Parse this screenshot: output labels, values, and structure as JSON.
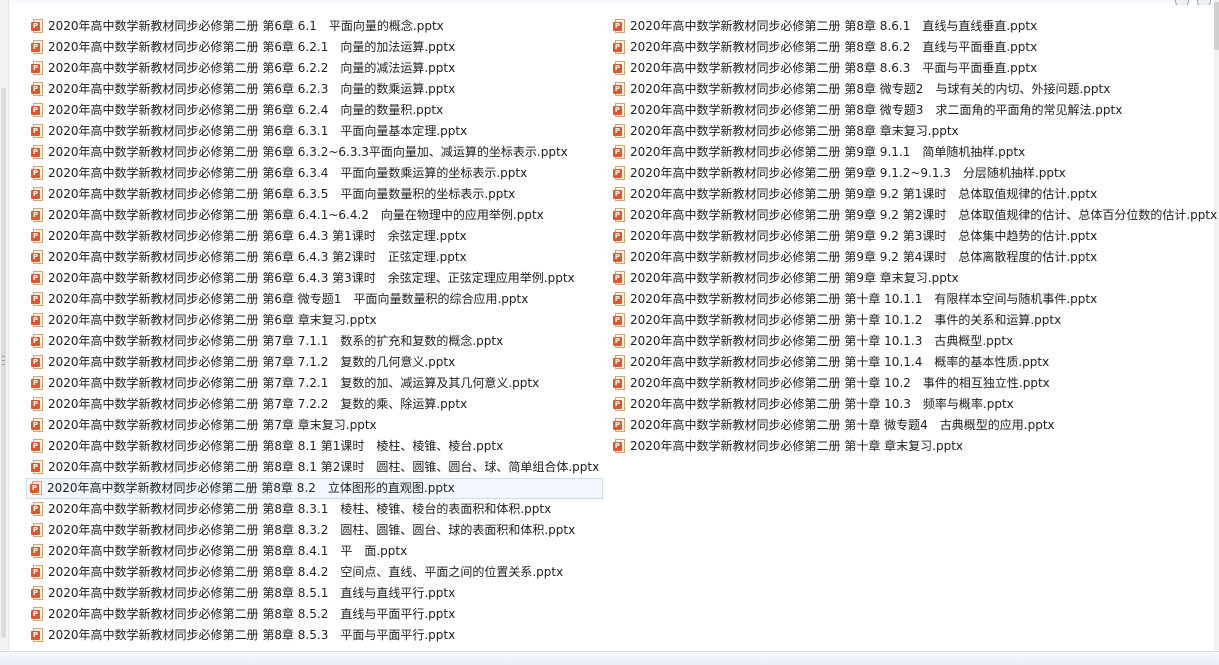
{
  "icon": {
    "name": "pptx-file-icon",
    "badge_letter": "P",
    "badge_color": "#e0572b"
  },
  "files_left": [
    "2020年高中数学新教材同步必修第二册 第6章 6.1　平面向量的概念.pptx",
    "2020年高中数学新教材同步必修第二册 第6章 6.2.1　向量的加法运算.pptx",
    "2020年高中数学新教材同步必修第二册 第6章 6.2.2　向量的减法运算.pptx",
    "2020年高中数学新教材同步必修第二册 第6章 6.2.3　向量的数乘运算.pptx",
    "2020年高中数学新教材同步必修第二册 第6章 6.2.4　向量的数量积.pptx",
    "2020年高中数学新教材同步必修第二册 第6章 6.3.1　平面向量基本定理.pptx",
    "2020年高中数学新教材同步必修第二册 第6章 6.3.2~6.3.3平面向量加、减运算的坐标表示.pptx",
    "2020年高中数学新教材同步必修第二册 第6章 6.3.4　平面向量数乘运算的坐标表示.pptx",
    "2020年高中数学新教材同步必修第二册 第6章 6.3.5　平面向量数量积的坐标表示.pptx",
    "2020年高中数学新教材同步必修第二册 第6章 6.4.1~6.4.2　向量在物理中的应用举例.pptx",
    "2020年高中数学新教材同步必修第二册 第6章 6.4.3 第1课时　余弦定理.pptx",
    "2020年高中数学新教材同步必修第二册 第6章 6.4.3 第2课时　正弦定理.pptx",
    "2020年高中数学新教材同步必修第二册 第6章 6.4.3 第3课时　余弦定理、正弦定理应用举例.pptx",
    "2020年高中数学新教材同步必修第二册 第6章 微专题1　平面向量数量积的综合应用.pptx",
    "2020年高中数学新教材同步必修第二册 第6章 章末复习.pptx",
    "2020年高中数学新教材同步必修第二册 第7章 7.1.1　数系的扩充和复数的概念.pptx",
    "2020年高中数学新教材同步必修第二册 第7章 7.1.2　复数的几何意义.pptx",
    "2020年高中数学新教材同步必修第二册 第7章 7.2.1　复数的加、减运算及其几何意义.pptx",
    "2020年高中数学新教材同步必修第二册 第7章 7.2.2　复数的乘、除运算.pptx",
    "2020年高中数学新教材同步必修第二册 第7章 章末复习.pptx",
    "2020年高中数学新教材同步必修第二册 第8章 8.1 第1课时　棱柱、棱锥、棱台.pptx",
    "2020年高中数学新教材同步必修第二册 第8章 8.1 第2课时　圆柱、圆锥、圆台、球、简单组合体.pptx",
    "2020年高中数学新教材同步必修第二册 第8章 8.2　立体图形的直观图.pptx",
    "2020年高中数学新教材同步必修第二册 第8章 8.3.1　棱柱、棱锥、棱台的表面积和体积.pptx",
    "2020年高中数学新教材同步必修第二册 第8章 8.3.2　圆柱、圆锥、圆台、球的表面积和体积.pptx",
    "2020年高中数学新教材同步必修第二册 第8章 8.4.1　平　面.pptx",
    "2020年高中数学新教材同步必修第二册 第8章 8.4.2　空间点、直线、平面之间的位置关系.pptx",
    "2020年高中数学新教材同步必修第二册 第8章 8.5.1　直线与直线平行.pptx",
    "2020年高中数学新教材同步必修第二册 第8章 8.5.2　直线与平面平行.pptx",
    "2020年高中数学新教材同步必修第二册 第8章 8.5.3　平面与平面平行.pptx"
  ],
  "files_right": [
    "2020年高中数学新教材同步必修第二册 第8章 8.6.1　直线与直线垂直.pptx",
    "2020年高中数学新教材同步必修第二册 第8章 8.6.2　直线与平面垂直.pptx",
    "2020年高中数学新教材同步必修第二册 第8章 8.6.3　平面与平面垂直.pptx",
    "2020年高中数学新教材同步必修第二册 第8章 微专题2　与球有关的内切、外接问题.pptx",
    "2020年高中数学新教材同步必修第二册 第8章 微专题3　求二面角的平面角的常见解法.pptx",
    "2020年高中数学新教材同步必修第二册 第8章 章末复习.pptx",
    "2020年高中数学新教材同步必修第二册 第9章 9.1.1　简单随机抽样.pptx",
    "2020年高中数学新教材同步必修第二册 第9章 9.1.2~9.1.3　分层随机抽样.pptx",
    "2020年高中数学新教材同步必修第二册 第9章 9.2 第1课时　总体取值规律的估计.pptx",
    "2020年高中数学新教材同步必修第二册 第9章 9.2 第2课时　总体取值规律的估计、总体百分位数的估计.pptx",
    "2020年高中数学新教材同步必修第二册 第9章 9.2 第3课时　总体集中趋势的估计.pptx",
    "2020年高中数学新教材同步必修第二册 第9章 9.2 第4课时　总体离散程度的估计.pptx",
    "2020年高中数学新教材同步必修第二册 第9章 章末复习.pptx",
    "2020年高中数学新教材同步必修第二册 第十章 10.1.1　有限样本空间与随机事件.pptx",
    "2020年高中数学新教材同步必修第二册 第十章 10.1.2　事件的关系和运算.pptx",
    "2020年高中数学新教材同步必修第二册 第十章 10.1.3　古典概型.pptx",
    "2020年高中数学新教材同步必修第二册 第十章 10.1.4　概率的基本性质.pptx",
    "2020年高中数学新教材同步必修第二册 第十章 10.2　事件的相互独立性.pptx",
    "2020年高中数学新教材同步必修第二册 第十章 10.3　频率与概率.pptx",
    "2020年高中数学新教材同步必修第二册 第十章 微专题4　古典概型的应用.pptx",
    "2020年高中数学新教材同步必修第二册 第十章 章末复习.pptx"
  ],
  "selected_index_left": 22
}
